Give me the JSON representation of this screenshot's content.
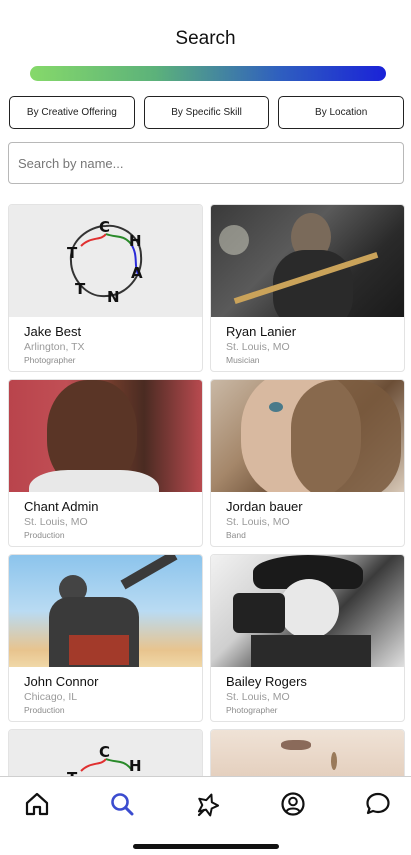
{
  "header": {
    "title": "Search"
  },
  "filters": [
    {
      "label": "By Creative Offering"
    },
    {
      "label": "By Specific Skill"
    },
    {
      "label": "By Location"
    }
  ],
  "search": {
    "placeholder": "Search by name...",
    "value": ""
  },
  "cards": [
    {
      "name": "Jake Best",
      "location": "Arlington, TX",
      "category": "Photographer",
      "photo": "chant-logo"
    },
    {
      "name": "Ryan Lanier",
      "location": "St. Louis, MO",
      "category": "Musician",
      "photo": "band-performance"
    },
    {
      "name": "Chant Admin",
      "location": "St. Louis, MO",
      "category": "Production",
      "photo": "portrait"
    },
    {
      "name": "Jordan bauer",
      "location": "St. Louis, MO",
      "category": "Band",
      "photo": "selfie"
    },
    {
      "name": "John Connor",
      "location": "Chicago, IL",
      "category": "Production",
      "photo": "climber"
    },
    {
      "name": "Bailey Rogers",
      "location": "St. Louis, MO",
      "category": "Photographer",
      "photo": "photographer-bw"
    },
    {
      "name": "",
      "location": "",
      "category": "",
      "photo": "chant-logo"
    },
    {
      "name": "",
      "location": "",
      "category": "",
      "photo": "face"
    }
  ],
  "logo_letters": "CHANT",
  "tabs": [
    {
      "icon": "home-icon",
      "active": false
    },
    {
      "icon": "search-icon",
      "active": true
    },
    {
      "icon": "star-pin-icon",
      "active": false
    },
    {
      "icon": "profile-icon",
      "active": false
    },
    {
      "icon": "chat-icon",
      "active": false
    }
  ],
  "colors": {
    "accent": "#3b4ccf",
    "gradient_start": "#86d96a",
    "gradient_end": "#1a22d8"
  }
}
